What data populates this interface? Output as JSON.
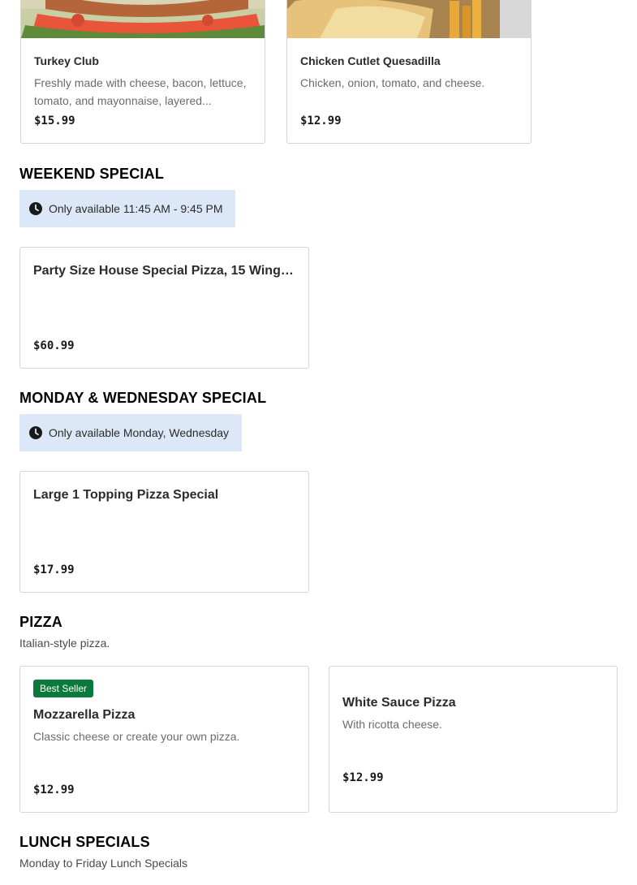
{
  "top_items": [
    {
      "name": "Turkey Club",
      "description": "Freshly made with cheese, bacon, lettuce, tomato, and mayonnaise, layered...",
      "price": "$15.99",
      "image_icon": "turkey-club-photo"
    },
    {
      "name": "Chicken Cutlet Quesadilla",
      "description": "Chicken, onion, tomato, and cheese.",
      "price": "$12.99",
      "image_icon": "quesadilla-photo"
    }
  ],
  "sections": {
    "weekend": {
      "title": "WEEKEND SPECIAL",
      "availability": "Only available 11:45 AM - 9:45 PM",
      "items": [
        {
          "name": "Party Size House Special Pizza, 15 Wings ...",
          "price": "$60.99"
        }
      ]
    },
    "monwed": {
      "title": "MONDAY & WEDNESDAY SPECIAL",
      "availability": "Only available Monday, Wednesday",
      "items": [
        {
          "name": "Large 1 Topping Pizza Special",
          "price": "$17.99"
        }
      ]
    },
    "pizza": {
      "title": "PIZZA",
      "subtitle": "Italian-style pizza.",
      "items": [
        {
          "badge": "Best Seller",
          "name": "Mozzarella Pizza",
          "description": "Classic cheese or create your own pizza.",
          "price": "$12.99"
        },
        {
          "name": "White Sauce Pizza",
          "description": "With ricotta cheese.",
          "price": "$12.99"
        }
      ]
    },
    "lunch": {
      "title": "LUNCH SPECIALS",
      "subtitle": "Monday to Friday Lunch Specials"
    }
  },
  "colors": {
    "availability_bg": "#dce8f7",
    "badge_bg": "#0a7a3c",
    "card_border": "#d6d6d6"
  },
  "icons": {
    "availability": "clock-icon"
  }
}
